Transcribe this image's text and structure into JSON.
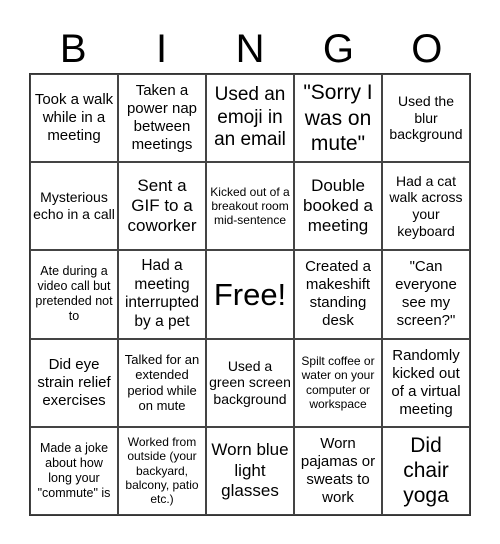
{
  "header": [
    "B",
    "I",
    "N",
    "G",
    "O"
  ],
  "cells": [
    "Took a walk while in a meeting",
    "Taken a power nap between meetings",
    "Used an emoji in an email",
    "\"Sorry I was on mute\"",
    "Used the blur background",
    "Mysterious echo in a call",
    "Sent a GIF to a coworker",
    "Kicked out of a breakout room mid-sentence",
    "Double booked a meeting",
    "Had a cat walk across your keyboard",
    "Ate during a video call but pretended not to",
    "Had a meeting interrupted by a pet",
    "Free!",
    "Created a makeshift standing desk",
    "\"Can everyone see my screen?\"",
    "Did eye strain relief exercises",
    "Talked for an extended period while on mute",
    "Used a green screen background",
    "Spilt coffee or water on your computer or workspace",
    "Randomly kicked out of a virtual meeting",
    "Made a joke about how long your \"commute\" is",
    "Worked from outside (your backyard, balcony, patio etc.)",
    "Worn blue light glasses",
    "Worn pajamas or sweats to work",
    "Did chair yoga"
  ]
}
